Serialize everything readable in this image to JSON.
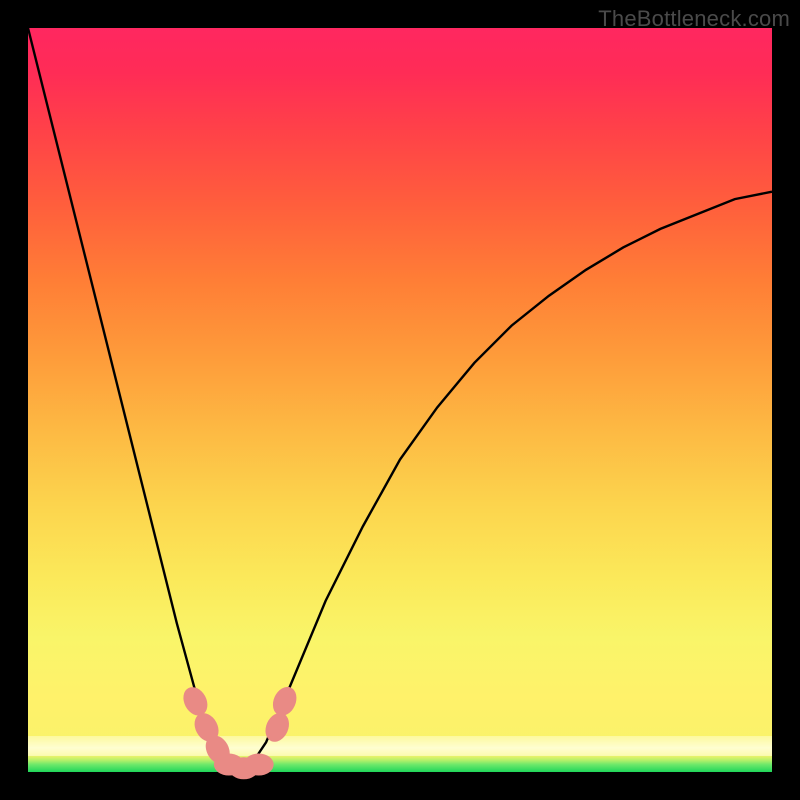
{
  "watermark": "TheBottleneck.com",
  "colors": {
    "frame": "#000000",
    "curve": "#000000",
    "sausage": "#e98a85",
    "gradient_top": "#ff2760",
    "gradient_mid": "#ffc944",
    "gradient_low": "#f8f56a",
    "gradient_bottom": "#1fd65a"
  },
  "chart_data": {
    "type": "line",
    "title": "",
    "xlabel": "",
    "ylabel": "",
    "xlim": [
      0,
      100
    ],
    "ylim": [
      0,
      100
    ],
    "grid": false,
    "series": [
      {
        "name": "bottleneck-curve",
        "x": [
          0,
          5,
          10,
          15,
          20,
          23,
          25,
          27,
          28,
          29,
          30,
          32,
          35,
          40,
          45,
          50,
          55,
          60,
          65,
          70,
          75,
          80,
          85,
          90,
          95,
          100
        ],
        "values": [
          100,
          80,
          60,
          40,
          20,
          9,
          4,
          1,
          0,
          0,
          1,
          4,
          11,
          23,
          33,
          42,
          49,
          55,
          60,
          64,
          67.5,
          70.5,
          73,
          75,
          77,
          78
        ]
      }
    ],
    "annotations": [
      {
        "name": "sausage-left-1",
        "x": 22.5,
        "y": 9.5
      },
      {
        "name": "sausage-left-2",
        "x": 24.0,
        "y": 6.0
      },
      {
        "name": "sausage-left-3",
        "x": 25.5,
        "y": 3.0
      },
      {
        "name": "sausage-bottom-1",
        "x": 27.0,
        "y": 1.0
      },
      {
        "name": "sausage-bottom-2",
        "x": 29.0,
        "y": 0.5
      },
      {
        "name": "sausage-bottom-3",
        "x": 31.0,
        "y": 1.0
      },
      {
        "name": "sausage-right-1",
        "x": 33.5,
        "y": 6.0
      },
      {
        "name": "sausage-right-2",
        "x": 34.5,
        "y": 9.5
      }
    ]
  }
}
